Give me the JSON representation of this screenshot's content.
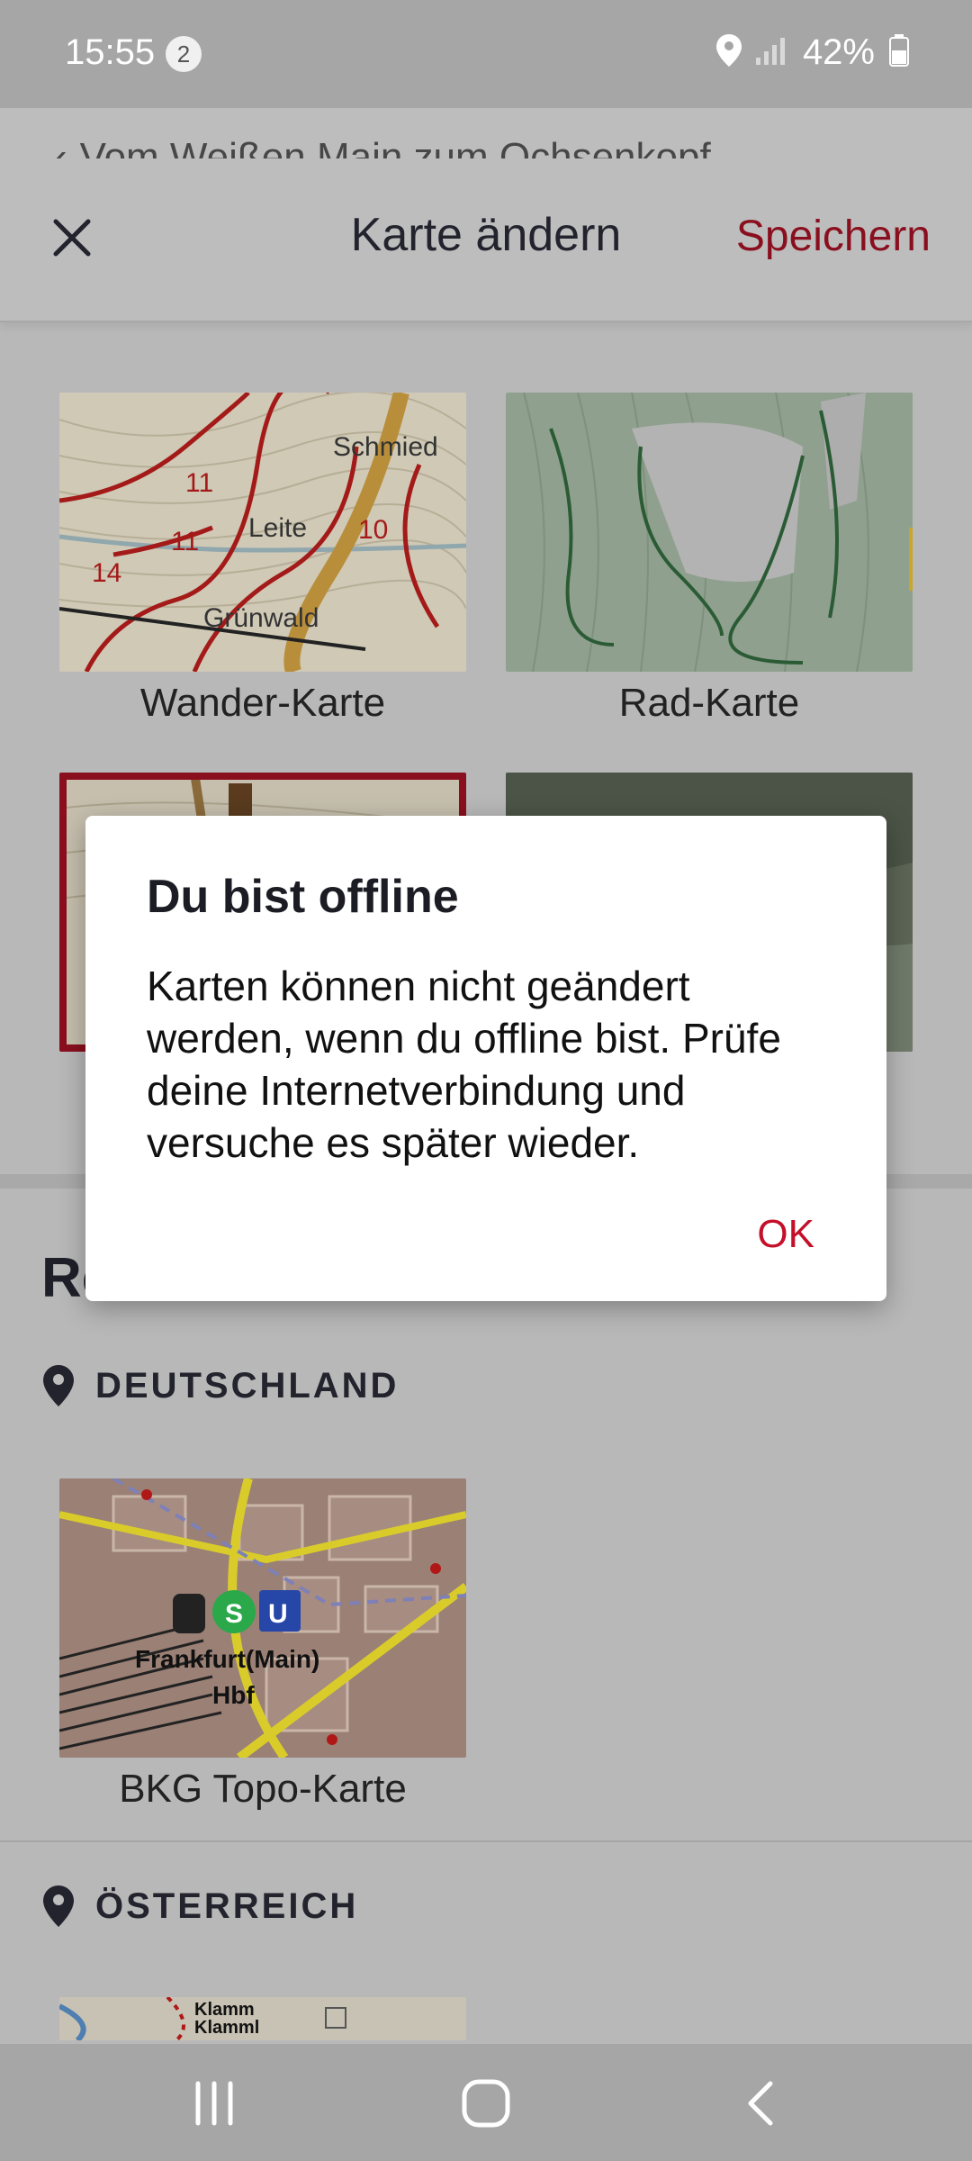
{
  "status_bar": {
    "time": "15:55",
    "notification_count": "2",
    "battery": "42%"
  },
  "background_page": {
    "title": "Vom Weißen Main zum Ochsenkopf"
  },
  "sheet": {
    "title": "Karte ändern",
    "save_label": "Speichern",
    "section_heading": "Re",
    "maps": [
      {
        "label": "Wander-Karte",
        "selected": false
      },
      {
        "label": "Rad-Karte",
        "selected": false
      },
      {
        "label": "",
        "selected": true
      },
      {
        "label": "",
        "selected": false
      }
    ],
    "wander_map_text": {
      "schmied": "Schmied",
      "leite": "Leite",
      "gruenwald": "Grünwald",
      "n11a": "11",
      "n11b": "11",
      "n10": "10",
      "n14": "14"
    },
    "regions": [
      {
        "name": "DEUTSCHLAND",
        "maps": [
          {
            "label": "BKG Topo-Karte",
            "thumb_text": [
              "Frankfurt(Main)",
              "Hbf"
            ]
          }
        ]
      },
      {
        "name": "ÖSTERREICH",
        "maps": [
          {
            "label": "",
            "thumb_text": [
              "Klamm",
              "Klamml"
            ]
          }
        ]
      }
    ]
  },
  "dialog": {
    "title": "Du bist offline",
    "body": "Karten können nicht geändert werden, wenn du offline bist. Prüfe deine Internetverbindung und versuche es später wieder.",
    "ok_label": "OK"
  },
  "colors": {
    "accent": "#c4102a",
    "save": "#8a0f1e",
    "scrim": "#a6a6a6"
  }
}
